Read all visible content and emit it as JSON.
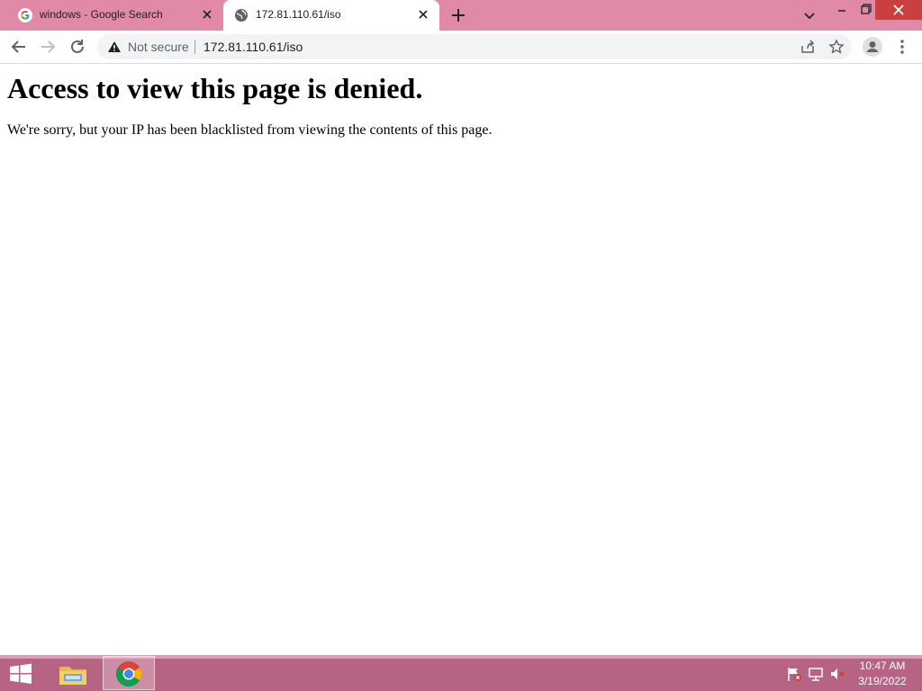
{
  "browser": {
    "tabs": [
      {
        "title": "windows - Google Search",
        "icon": "google-icon",
        "active": false
      },
      {
        "title": "172.81.110.61/iso",
        "icon": "globe-icon",
        "active": true
      }
    ],
    "window_controls": [
      "minimize-icon",
      "restore-icon",
      "close-icon"
    ],
    "address_bar": {
      "security_label": "Not secure",
      "url": "172.81.110.61/iso"
    },
    "colors": {
      "frame": "#e08aa8",
      "close_button": "#c9403f"
    }
  },
  "page": {
    "heading": "Access to view this page is denied.",
    "message": "We're sorry, but your IP has been blacklisted from viewing the contents of this page."
  },
  "taskbar": {
    "apps": [
      "windows-start-icon",
      "file-explorer-icon",
      "chrome-icon"
    ],
    "tray_icons": [
      "action-center-flag-icon",
      "network-icon",
      "volume-muted-icon"
    ],
    "clock": {
      "time": "10:47 AM",
      "date": "3/19/2022"
    },
    "color": "#b76383"
  }
}
